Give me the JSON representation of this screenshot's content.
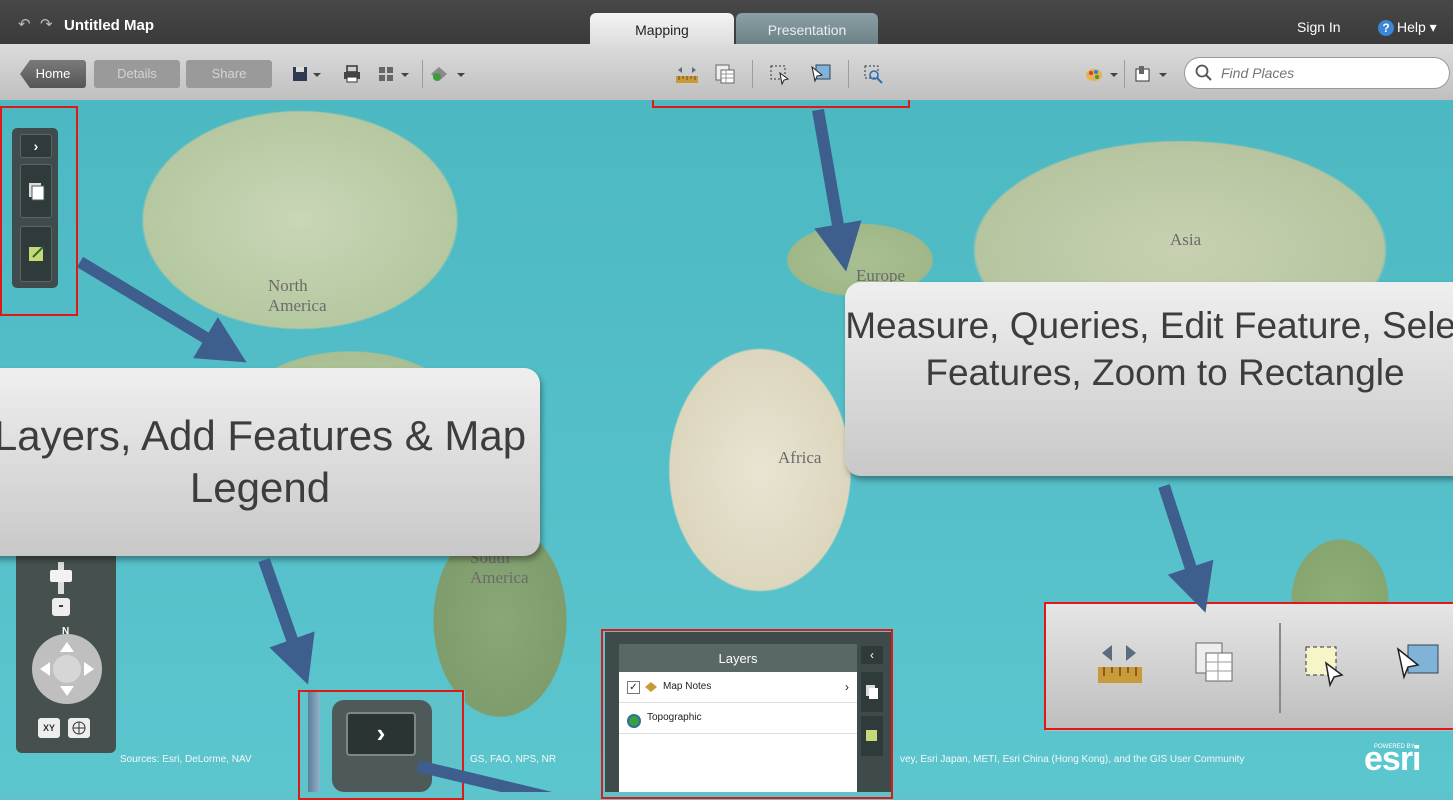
{
  "app": {
    "title": "Untitled Map",
    "tabs": [
      {
        "label": "Mapping",
        "active": true
      },
      {
        "label": "Presentation",
        "active": false
      }
    ],
    "sign_in": "Sign In",
    "help": "Help"
  },
  "toolbar": {
    "home": "Home",
    "details": "Details",
    "share": "Share",
    "icons_left": [
      "save-icon",
      "print-icon",
      "basemap-grid-icon",
      "add-feature-icon"
    ],
    "icons_center": [
      "measure-icon",
      "query-table-icon",
      "edit-feature-icon",
      "select-features-icon",
      "zoom-rectangle-icon"
    ],
    "icons_right": [
      "palette-icon",
      "bookmark-icon"
    ],
    "search_placeholder": "Find Places"
  },
  "map": {
    "labels": [
      "North America",
      "South America",
      "Europe",
      "Africa",
      "Asia"
    ],
    "attribution_left": "Sources: Esri, DeLorme, NAV",
    "attribution_mid": "GS, FAO, NPS, NR",
    "attribution_right": "vey, Esri Japan, METI, Esri China (Hong Kong), and the GIS User Community",
    "powered_by": "POWERED BY",
    "logo": "esri",
    "nav_north": "N",
    "nav_xy": "XY",
    "zoom_out": "-"
  },
  "callouts": {
    "left": "Layers, Add Features & Map Legend",
    "right": "Measure, Queries, Edit Feature, Select Features, Zoom to Rectangle"
  },
  "layers_panel": {
    "title": "Layers",
    "items": [
      {
        "label": "Map Notes",
        "checked": true
      },
      {
        "label": "Topographic",
        "checked": false
      }
    ]
  },
  "colors": {
    "highlight": "#e01818",
    "arrow": "#3e5f8e",
    "ocean": "#5cc6cf",
    "toolbar": "#cfcfcf"
  }
}
